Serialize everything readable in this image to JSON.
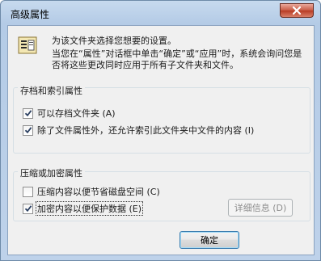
{
  "window": {
    "title": "高级属性"
  },
  "header": {
    "line1": "为该文件夹选择您想要的设置。",
    "line2": "当您在“属性”对话框中单击“确定”或“应用”时，系统会询问您是否将这些更改同时应用于所有子文件夹和文件。"
  },
  "archive_group": {
    "label": "存档和索引属性",
    "options": [
      {
        "label": "可以存档文件夹 (A)",
        "checked": true
      },
      {
        "label": "除了文件属性外，还允许索引此文件夹中文件的内容 (I)",
        "checked": true
      }
    ]
  },
  "compress_group": {
    "label": "压缩或加密属性",
    "options": [
      {
        "label": "压缩内容以便节省磁盘空间 (C)",
        "checked": false
      },
      {
        "label": "加密内容以便保护数据 (E)",
        "checked": true
      }
    ],
    "details_button": "详细信息 (D)"
  },
  "footer": {
    "ok_button": "确定"
  }
}
